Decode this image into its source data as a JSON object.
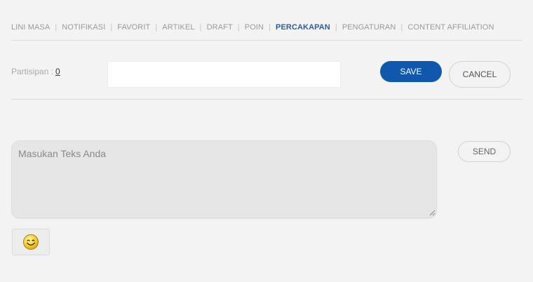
{
  "nav": {
    "items": [
      {
        "label": "LINI MASA"
      },
      {
        "label": "NOTIFIKASI"
      },
      {
        "label": "FAVORIT"
      },
      {
        "label": "ARTIKEL"
      },
      {
        "label": "DRAFT"
      },
      {
        "label": "POIN"
      },
      {
        "label": "PERCAKAPAN"
      },
      {
        "label": "PENGATURAN"
      },
      {
        "label": "CONTENT AFFILIATION"
      }
    ],
    "separator": "|",
    "active": "PERCAKAPAN"
  },
  "conversation": {
    "participants_label": "Partisipan :",
    "participants_count": "0",
    "name_input_value": "",
    "save_label": "SAVE",
    "cancel_label": "CANCEL"
  },
  "composer": {
    "placeholder": "Masukan Teks Anda",
    "value": "",
    "send_label": "SEND",
    "emoji_icon": "smiley-face-icon"
  },
  "colors": {
    "accent": "#0f58ad",
    "active_nav": "#2c5d9c",
    "background": "#f3f3f3"
  }
}
